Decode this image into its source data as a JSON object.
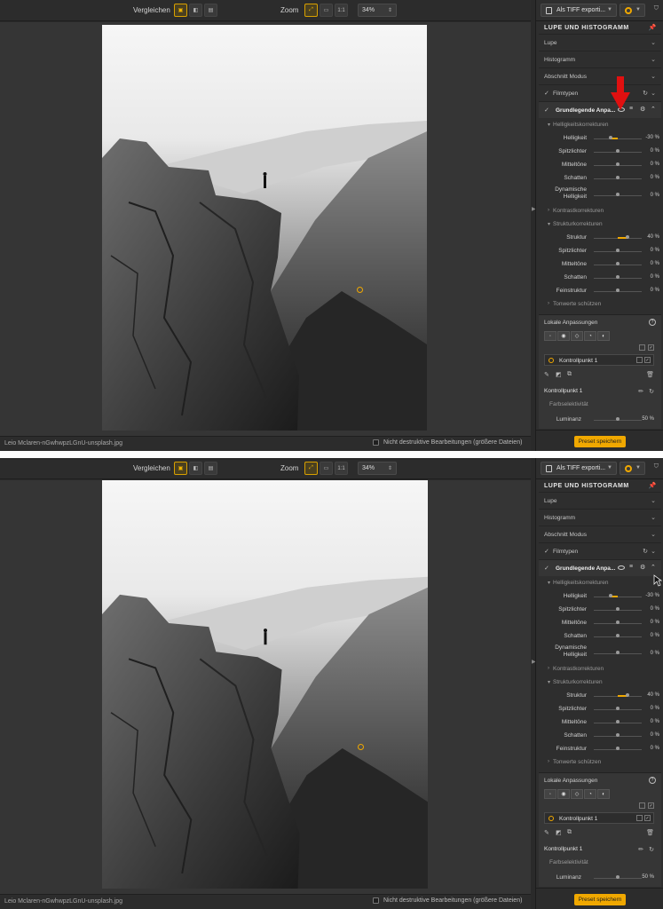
{
  "toolbar": {
    "compare_label": "Vergleichen",
    "zoom_label": "Zoom",
    "zoom_value": "34%",
    "one_to_one": "1:1"
  },
  "status": {
    "filename": "Leio Mclaren-nGwhwpzLGnU-unsplash.jpg",
    "nondestructive_label": "Nicht destruktive Bearbeitungen (größere Dateien)"
  },
  "panel": {
    "export_label": "Als TIFF exporti...",
    "section_title": "LUPE UND HISTOGRAMM",
    "accordion": [
      "Lupe",
      "Histogramm",
      "Abschnitt Modus"
    ],
    "filmtypen": "Filmtypen",
    "grund_title": "Grundlegende Anpa...",
    "helligkeit_head": "Helligkeitskorrekturen",
    "helligkeit_rows": [
      {
        "label": "Helligkeit",
        "value": "-30 %",
        "level": -30
      },
      {
        "label": "Spitzlichter",
        "value": "0 %",
        "level": 0
      },
      {
        "label": "Mitteltöne",
        "value": "0 %",
        "level": 0
      },
      {
        "label": "Schatten",
        "value": "0 %",
        "level": 0
      },
      {
        "label": "Dynamische Helligkeit",
        "value": "0 %",
        "level": 0
      }
    ],
    "kontrast_head": "Kontrastkorrekturen",
    "struktur_head": "Strukturkorrekturen",
    "struktur_rows": [
      {
        "label": "Struktur",
        "value": "40 %",
        "level": 40
      },
      {
        "label": "Spitzlichter",
        "value": "0 %",
        "level": 0
      },
      {
        "label": "Mitteltöne",
        "value": "0 %",
        "level": 0
      },
      {
        "label": "Schatten",
        "value": "0 %",
        "level": 0
      },
      {
        "label": "Feinstruktur",
        "value": "0 %",
        "level": 0
      }
    ],
    "tonwerte_head": "Tonwerte schützen",
    "local_title": "Lokale Anpassungen",
    "control_point_name": "Kontrollpunkt 1",
    "kp_detail_title": "Kontrollpunkt 1",
    "farbselektivitaet": "Farbselektivität",
    "luminanz": {
      "label": "Luminanz",
      "value": "50 %",
      "level": 50
    },
    "preset_save": "Preset speichern"
  },
  "colors": {
    "accent": "#f0a800",
    "panel_bg": "#2e2e2e",
    "canvas_bg": "#353535",
    "annotation_arrow": "#e01010"
  },
  "icons": [
    "single-view-icon",
    "split-view-icon",
    "side-by-side-icon",
    "fit-icon",
    "fill-icon",
    "pin-icon",
    "eye-icon",
    "menu-icon",
    "gear-icon",
    "chevron-down-icon",
    "reset-icon",
    "trash-icon",
    "pencil-icon"
  ]
}
